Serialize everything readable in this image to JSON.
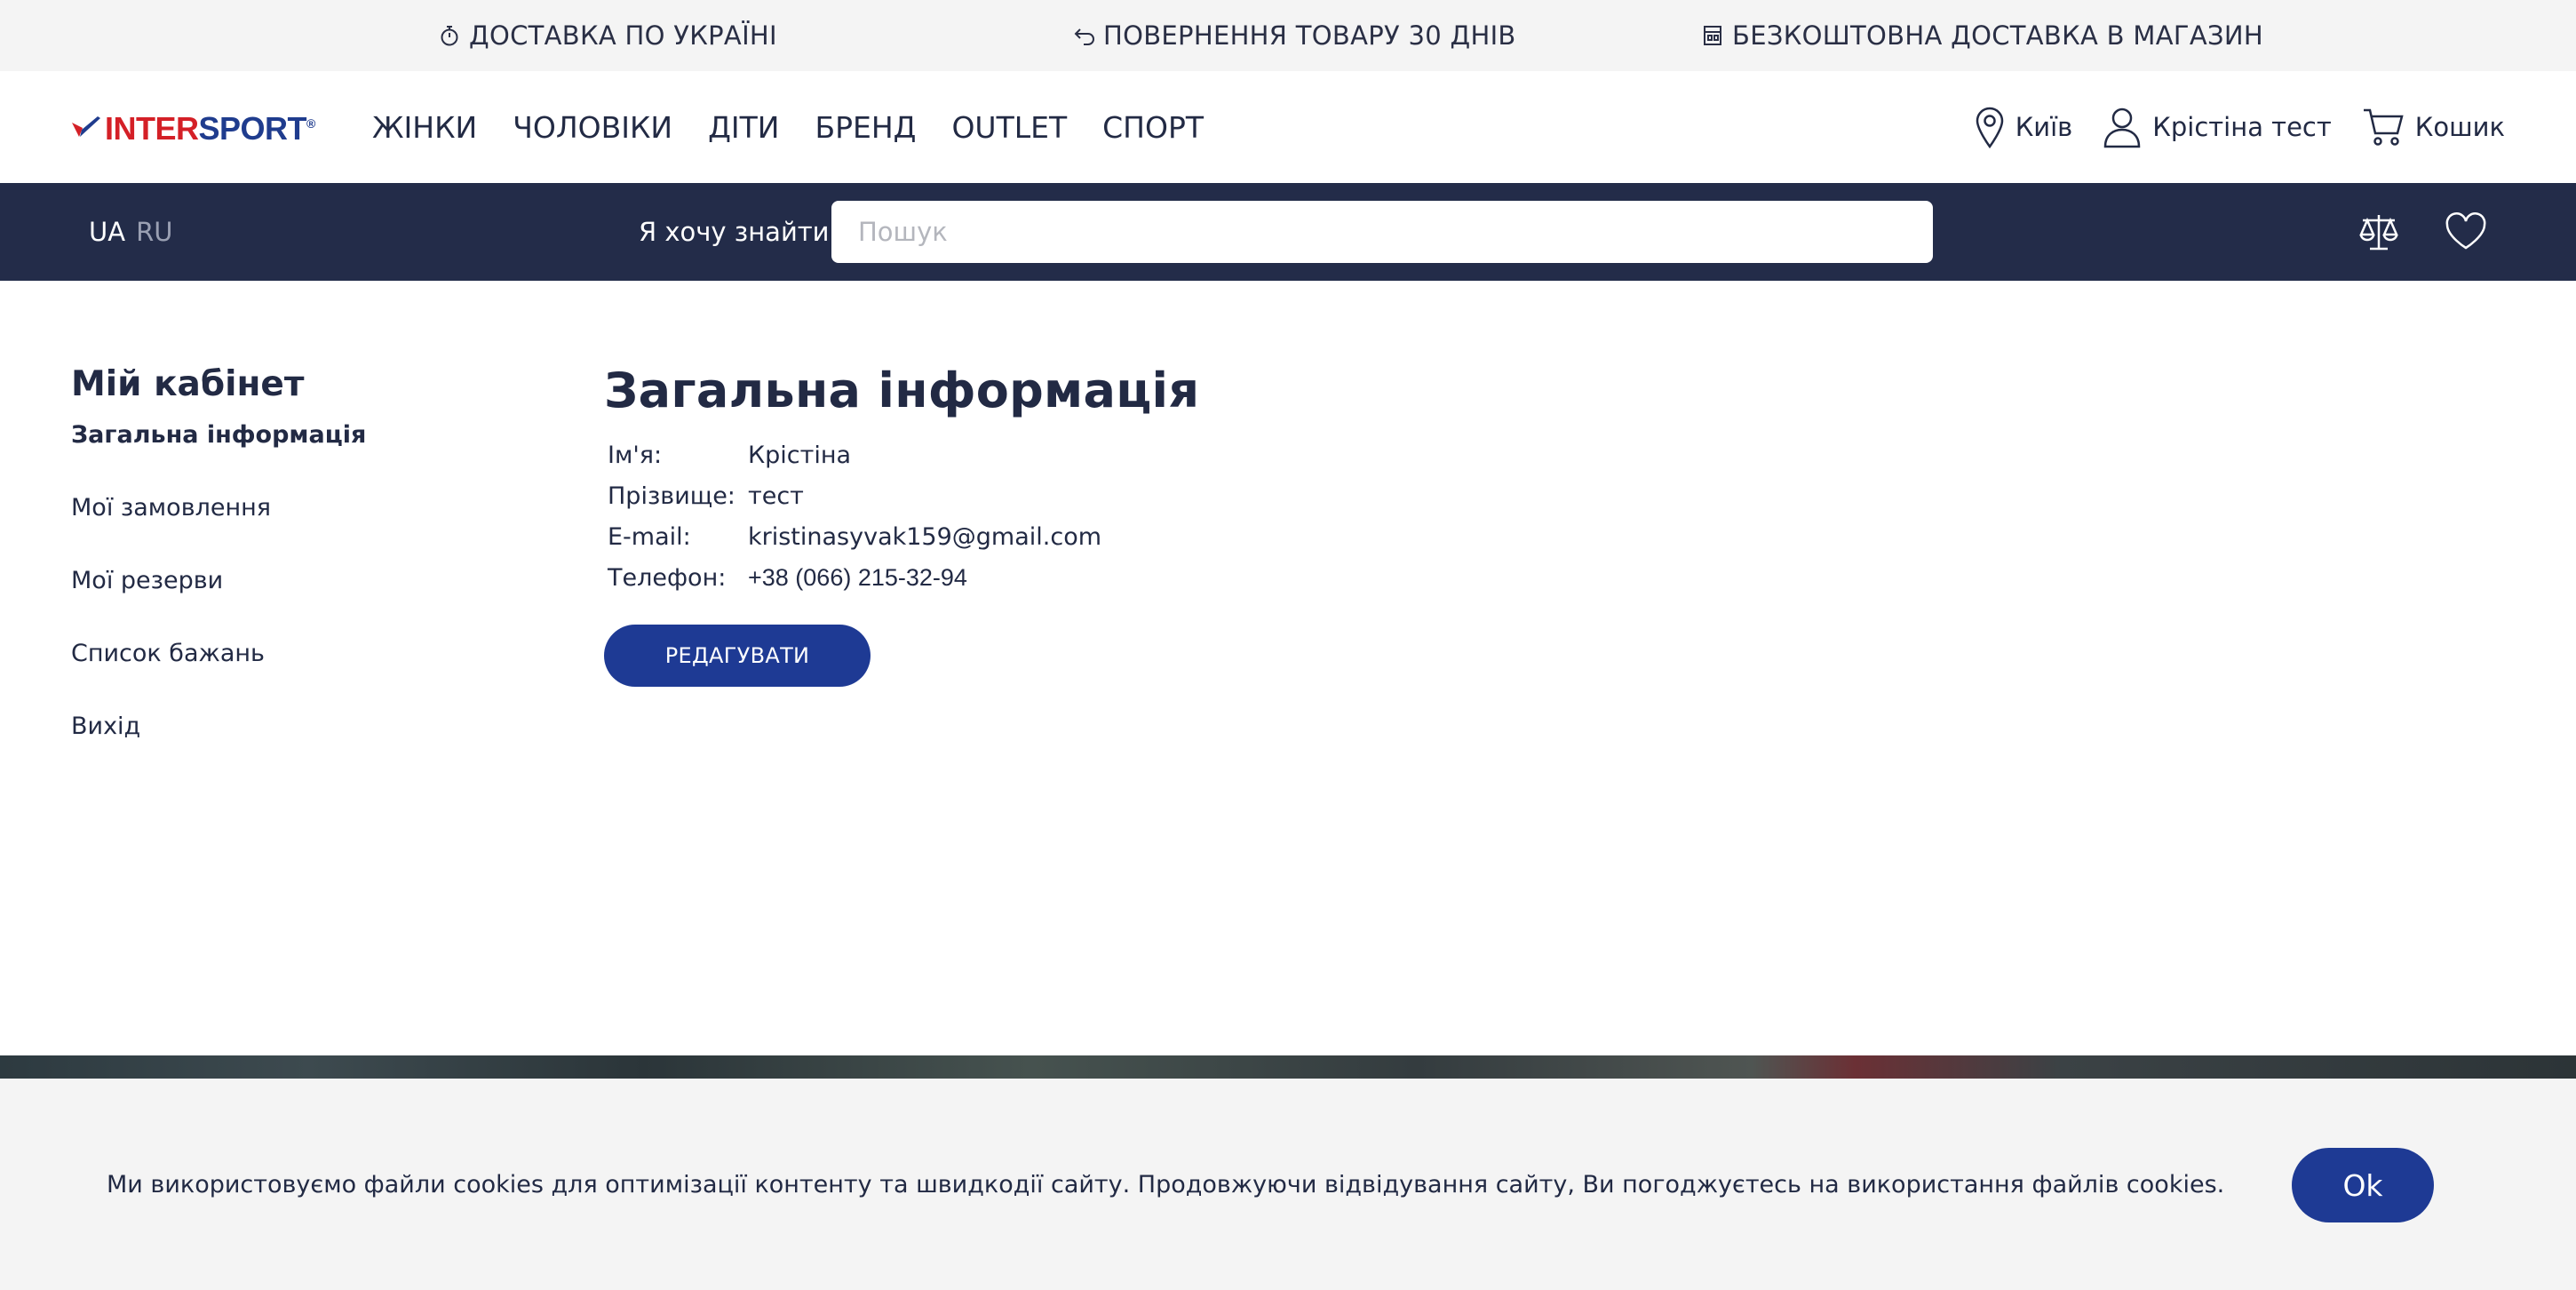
{
  "promo_bar": {
    "items": [
      {
        "icon": "stopwatch-icon",
        "label": "ДОСТАВКА ПО УКРАЇНІ"
      },
      {
        "icon": "return-arrow-icon",
        "label": "ПОВЕРНЕННЯ ТОВАРУ 30 ДНІВ"
      },
      {
        "icon": "store-icon",
        "label": "БЕЗКОШТОВНА ДОСТАВКА В МАГАЗИН"
      }
    ]
  },
  "header": {
    "logo": {
      "part1": "INTER",
      "part2": "SPORT",
      "registered": "®"
    },
    "nav": [
      "ЖІНКИ",
      "ЧОЛОВІКИ",
      "ДІТИ",
      "БРЕНД",
      "OUTLET",
      "СПОРТ"
    ],
    "city": "Київ",
    "user": "Крістіна тест",
    "cart": "Кошик"
  },
  "search_bar": {
    "lang_active": "UA",
    "lang_other": "RU",
    "label": "Я хочу знайти...",
    "placeholder": "Пошук",
    "value": ""
  },
  "sidebar": {
    "title": "Мій кабінет",
    "items": [
      "Загальна інформація",
      "Мої замовлення",
      "Мої резерви",
      "Список бажань",
      "Вихід"
    ]
  },
  "main": {
    "title": "Загальна інформація",
    "fields": [
      {
        "label": "Ім'я:",
        "value": "Крістіна"
      },
      {
        "label": "Прізвище:",
        "value": "тест"
      },
      {
        "label": "E-mail:",
        "value": "kristinasyvak159@gmail.com"
      },
      {
        "label": "Телефон:",
        "value": "+38 (066) 215-32-94"
      }
    ],
    "edit_label": "РЕДАГУВАТИ"
  },
  "cookie": {
    "text": "Ми використовуємо файли cookies для оптимізації контенту та швидкодії сайту. Продовжуючи відвідування сайту, Ви погоджуєтесь на використання файлів cookies.",
    "ok_label": "Ok"
  },
  "colors": {
    "brand_red": "#d42027",
    "brand_blue": "#1f3c8e",
    "navy_bar": "#232c49",
    "button_blue": "#1e3a94"
  }
}
